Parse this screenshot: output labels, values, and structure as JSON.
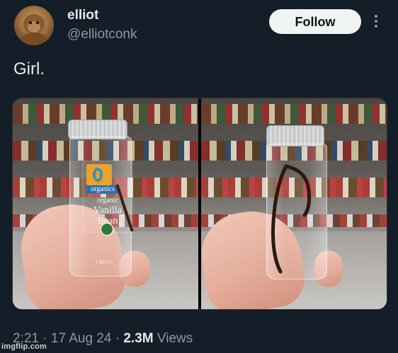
{
  "author": {
    "name": "elliot",
    "handle": "@elliotconk"
  },
  "header": {
    "follow_label": "Follow",
    "more_icon": "more-vertical-icon"
  },
  "tweet": {
    "text": "Girl."
  },
  "media": {
    "photos": [
      {
        "label_brand": "organics",
        "label_sub": "organic",
        "label_product_line1": "Vanilla",
        "label_product_line2": "Bean",
        "label_count": "1 BEAN"
      },
      {}
    ]
  },
  "footer": {
    "time": "2:21",
    "date": "17 Aug 24",
    "separator": "·",
    "views_count": "2.3M",
    "views_label": "Views"
  },
  "watermark": "imgflip.com",
  "colors": {
    "background": "#141e28",
    "text_primary": "#e7e9ea",
    "text_secondary": "#8b98a5",
    "follow_bg": "#eff3f4"
  }
}
